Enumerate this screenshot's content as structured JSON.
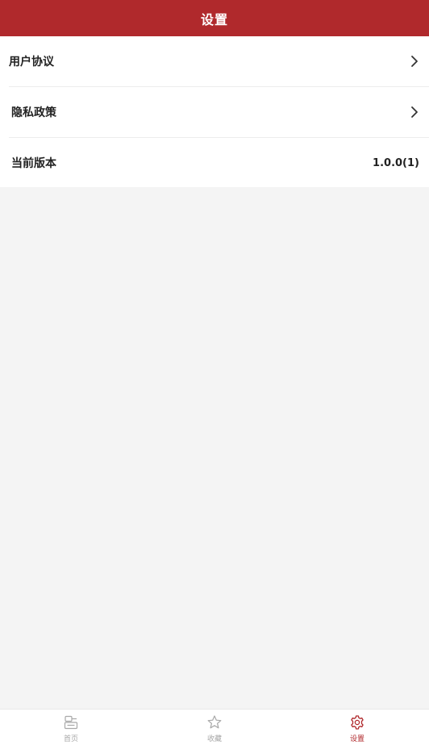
{
  "header": {
    "title": "设置"
  },
  "settings": {
    "items": [
      {
        "label": "用户协议",
        "value": "",
        "has_chevron": true
      },
      {
        "label": "隐私政策",
        "value": "",
        "has_chevron": true
      },
      {
        "label": "当前版本",
        "value": "1.0.0(1)",
        "has_chevron": false
      }
    ]
  },
  "tabbar": {
    "tabs": [
      {
        "label": "首页",
        "icon": "home-icon",
        "active": false
      },
      {
        "label": "收藏",
        "icon": "star-icon",
        "active": false
      },
      {
        "label": "设置",
        "icon": "gear-icon",
        "active": true
      }
    ]
  },
  "colors": {
    "brand": "#b0292c",
    "background": "#f4f4f4",
    "inactive": "#a8a8a8"
  }
}
